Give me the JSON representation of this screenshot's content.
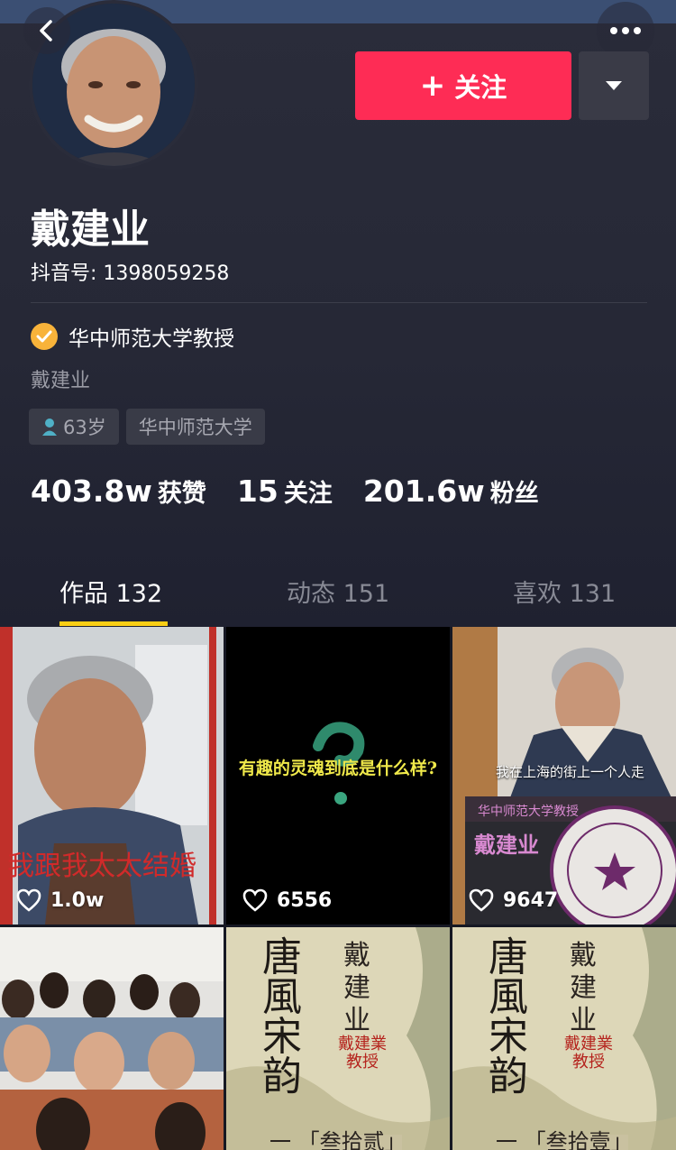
{
  "header": {
    "follow_label": "关注",
    "back_icon": "chevron-left-icon",
    "more_icon": "ellipsis-icon",
    "dropdown_icon": "caret-down-icon"
  },
  "profile": {
    "name": "戴建业",
    "douyin_id": "抖音号: 1398059258",
    "verified_label": "华中师范大学教授",
    "bio": "戴建业",
    "tags": [
      "63岁",
      "华中师范大学"
    ]
  },
  "stats": [
    {
      "num": "403.8w",
      "label": "获赞"
    },
    {
      "num": "15",
      "label": "关注"
    },
    {
      "num": "201.6w",
      "label": "粉丝"
    }
  ],
  "tabs": [
    {
      "label": "作品 132",
      "active": true
    },
    {
      "label": "动态 151",
      "active": false
    },
    {
      "label": "喜欢 131",
      "active": false
    }
  ],
  "videos": [
    {
      "likes": "1.0w",
      "caption": "我跟我太太结婚"
    },
    {
      "likes": "6556",
      "caption": "有趣的灵魂到底是什么样?"
    },
    {
      "likes": "9647",
      "caption": "我在上海的街上一个人走",
      "banner": "华中师范大学教授",
      "banner_name": "戴建业"
    },
    {
      "likes": "",
      "caption": ""
    },
    {
      "likes": "",
      "caption": "唐風宋韵",
      "author": "戴建业",
      "seal": "戴建業 教授",
      "episode": "一 「叁拾贰」"
    },
    {
      "likes": "",
      "caption": "唐風宋韵",
      "author": "戴建业",
      "seal": "戴建業 教授",
      "episode": "一 「叁拾壹」"
    }
  ],
  "colors": {
    "accent": "#fe2c55",
    "tab_indicator": "#face15",
    "verified": "#f8b33a",
    "background": "#161823"
  }
}
